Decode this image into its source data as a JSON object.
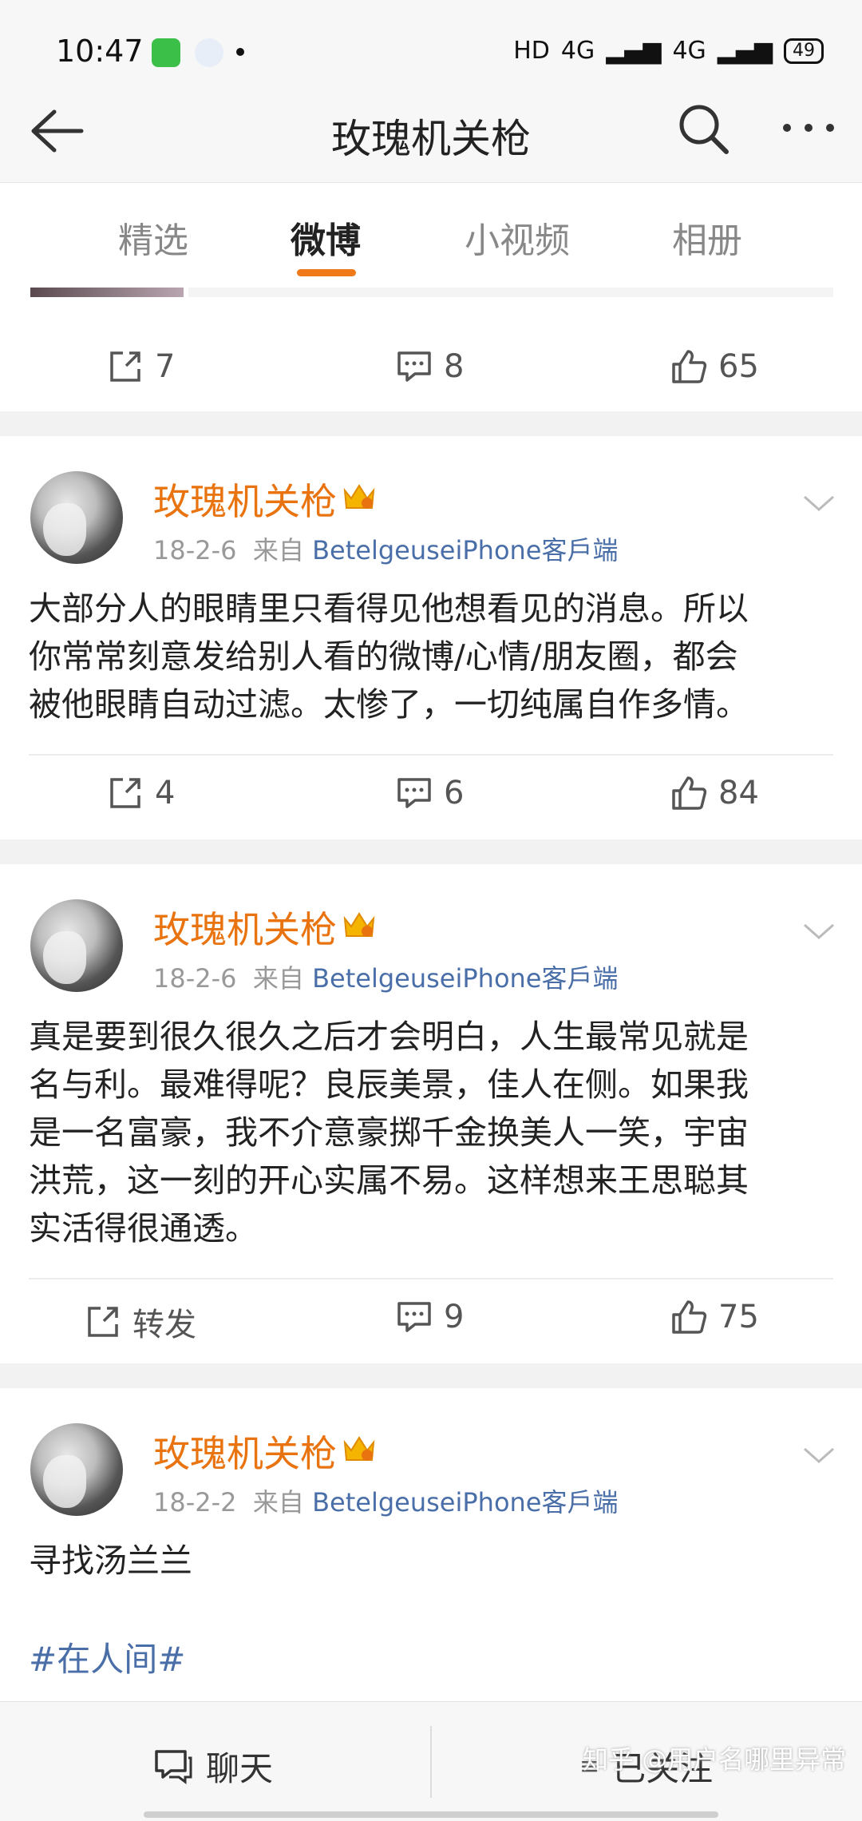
{
  "status_bar": {
    "time": "10:47",
    "signal_text": "HD",
    "network_1": "4G",
    "network_2": "4G",
    "battery": "49"
  },
  "nav": {
    "title": "玫瑰机关枪"
  },
  "tabs": [
    {
      "label": "精选"
    },
    {
      "label": "微博"
    },
    {
      "label": "小视频"
    },
    {
      "label": "相册"
    }
  ],
  "active_tab": "微博",
  "top_actions": {
    "repost": "7",
    "comment": "8",
    "like": "65"
  },
  "posts": [
    {
      "user": "玫瑰机关枪",
      "date": "18-2-6",
      "from_label": "来自",
      "source": "BetelgeuseiPhone客戶端",
      "lines": [
        "大部分人的眼睛里只看得见他想看见的消息。所以",
        "你常常刻意发给别人看的微博/心情/朋友圈，都会",
        "被他眼睛自动过滤。太惨了，一切纯属自作多情。"
      ],
      "repost": "4",
      "comment": "6",
      "like": "84"
    },
    {
      "user": "玫瑰机关枪",
      "date": "18-2-6",
      "from_label": "来自",
      "source": "BetelgeuseiPhone客戶端",
      "lines": [
        "真是要到很久很久之后才会明白，人生最常见就是",
        "名与利。最难得呢？良辰美景，佳人在侧。如果我",
        "是一名富豪，我不介意豪掷千金换美人一笑，宇宙",
        "洪荒，这一刻的开心实属不易。这样想来王思聪其",
        "实活得很通透。"
      ],
      "repost": "转发",
      "comment": "9",
      "like": "75"
    },
    {
      "user": "玫瑰机关枪",
      "date": "18-2-2",
      "from_label": "来自",
      "source": "BetelgeuseiPhone客戶端",
      "lines": [
        "寻找汤兰兰"
      ],
      "hashtag": "#在人间#"
    }
  ],
  "bottom": {
    "chat": "聊天",
    "followed": "已关注",
    "watermark": "知乎 @用户名哪里异常"
  },
  "colors": {
    "accent": "#f07a1a",
    "username": "#e8730f",
    "link": "#4a6ea8"
  }
}
